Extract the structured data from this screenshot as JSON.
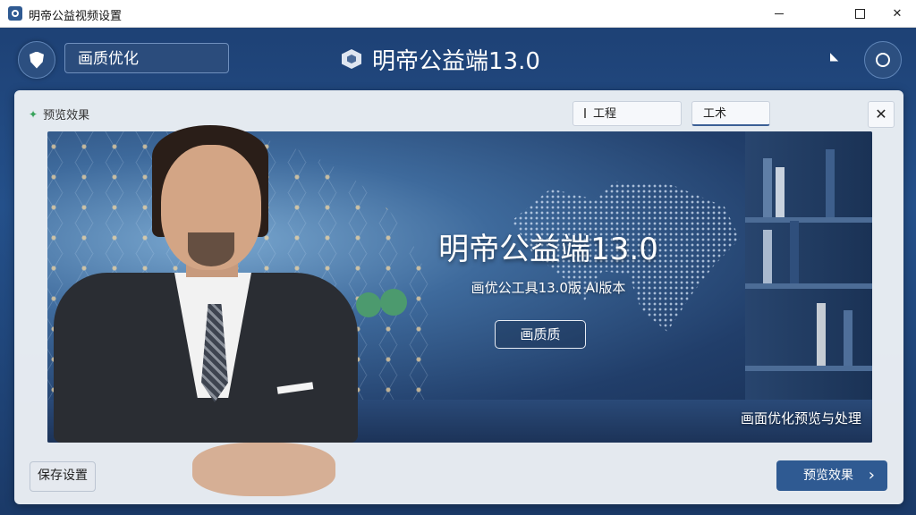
{
  "window": {
    "title": "明帝公益视频设置"
  },
  "header": {
    "mode_label": "画质优化",
    "brand": "明帝公益端13.0"
  },
  "panel": {
    "label": "预览效果",
    "tabs": [
      {
        "label": "工程"
      },
      {
        "label": "工术"
      }
    ]
  },
  "hero": {
    "title": "明帝公益端13.0",
    "subtitle": "画优公工具13.0版 AI版本",
    "button": "画质质",
    "caption": "画面优化预览与处理"
  },
  "footer": {
    "left_button": "保存设置",
    "right_button": "预览效果"
  },
  "colors": {
    "accent": "#2f5a92",
    "background": "#1d3f72",
    "sparkle": "#36a35a"
  }
}
